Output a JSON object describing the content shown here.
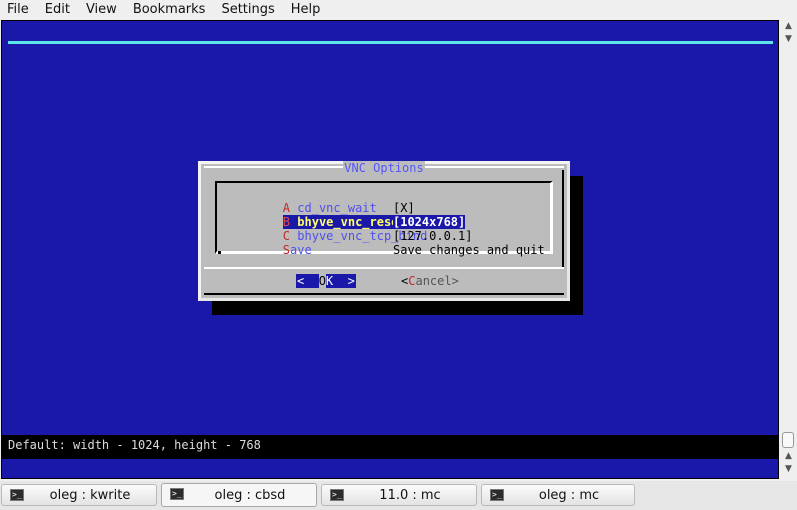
{
  "menubar": {
    "items": [
      "File",
      "Edit",
      "View",
      "Bookmarks",
      "Settings",
      "Help"
    ]
  },
  "dialog": {
    "title": "VNC Options",
    "items": [
      {
        "tag": "A",
        "name": "cd_vnc_wait",
        "value": "[X]"
      },
      {
        "tag": "B",
        "name": "bhyve_vnc_resolution",
        "value": "[1024x768]",
        "selected": true
      },
      {
        "tag": "C",
        "name": "bhyve_vnc_tcp_bind",
        "value": "[127.0.0.1]"
      },
      {
        "tag": "S",
        "name": "ave",
        "value": "Save changes and quit"
      }
    ],
    "ok_left": "<  ",
    "ok_hotkey": "O",
    "ok_right": "K  >",
    "cancel_left": "<",
    "cancel_hotkey": "C",
    "cancel_right": "ancel>"
  },
  "status_text": "Default: width - 1024, height - 768",
  "taskbar": {
    "tasks": [
      {
        "label": "oleg : kwrite"
      },
      {
        "label": "oleg : cbsd",
        "active": true
      },
      {
        "label": "11.0 : mc"
      },
      {
        "label": "oleg : mc"
      }
    ]
  },
  "colors": {
    "terminal_bg": "#1a18a8",
    "accent_cyan": "#5ce6ea",
    "dialog_bg": "#bcbcbc",
    "highlight_fg": "#ffff6b"
  }
}
